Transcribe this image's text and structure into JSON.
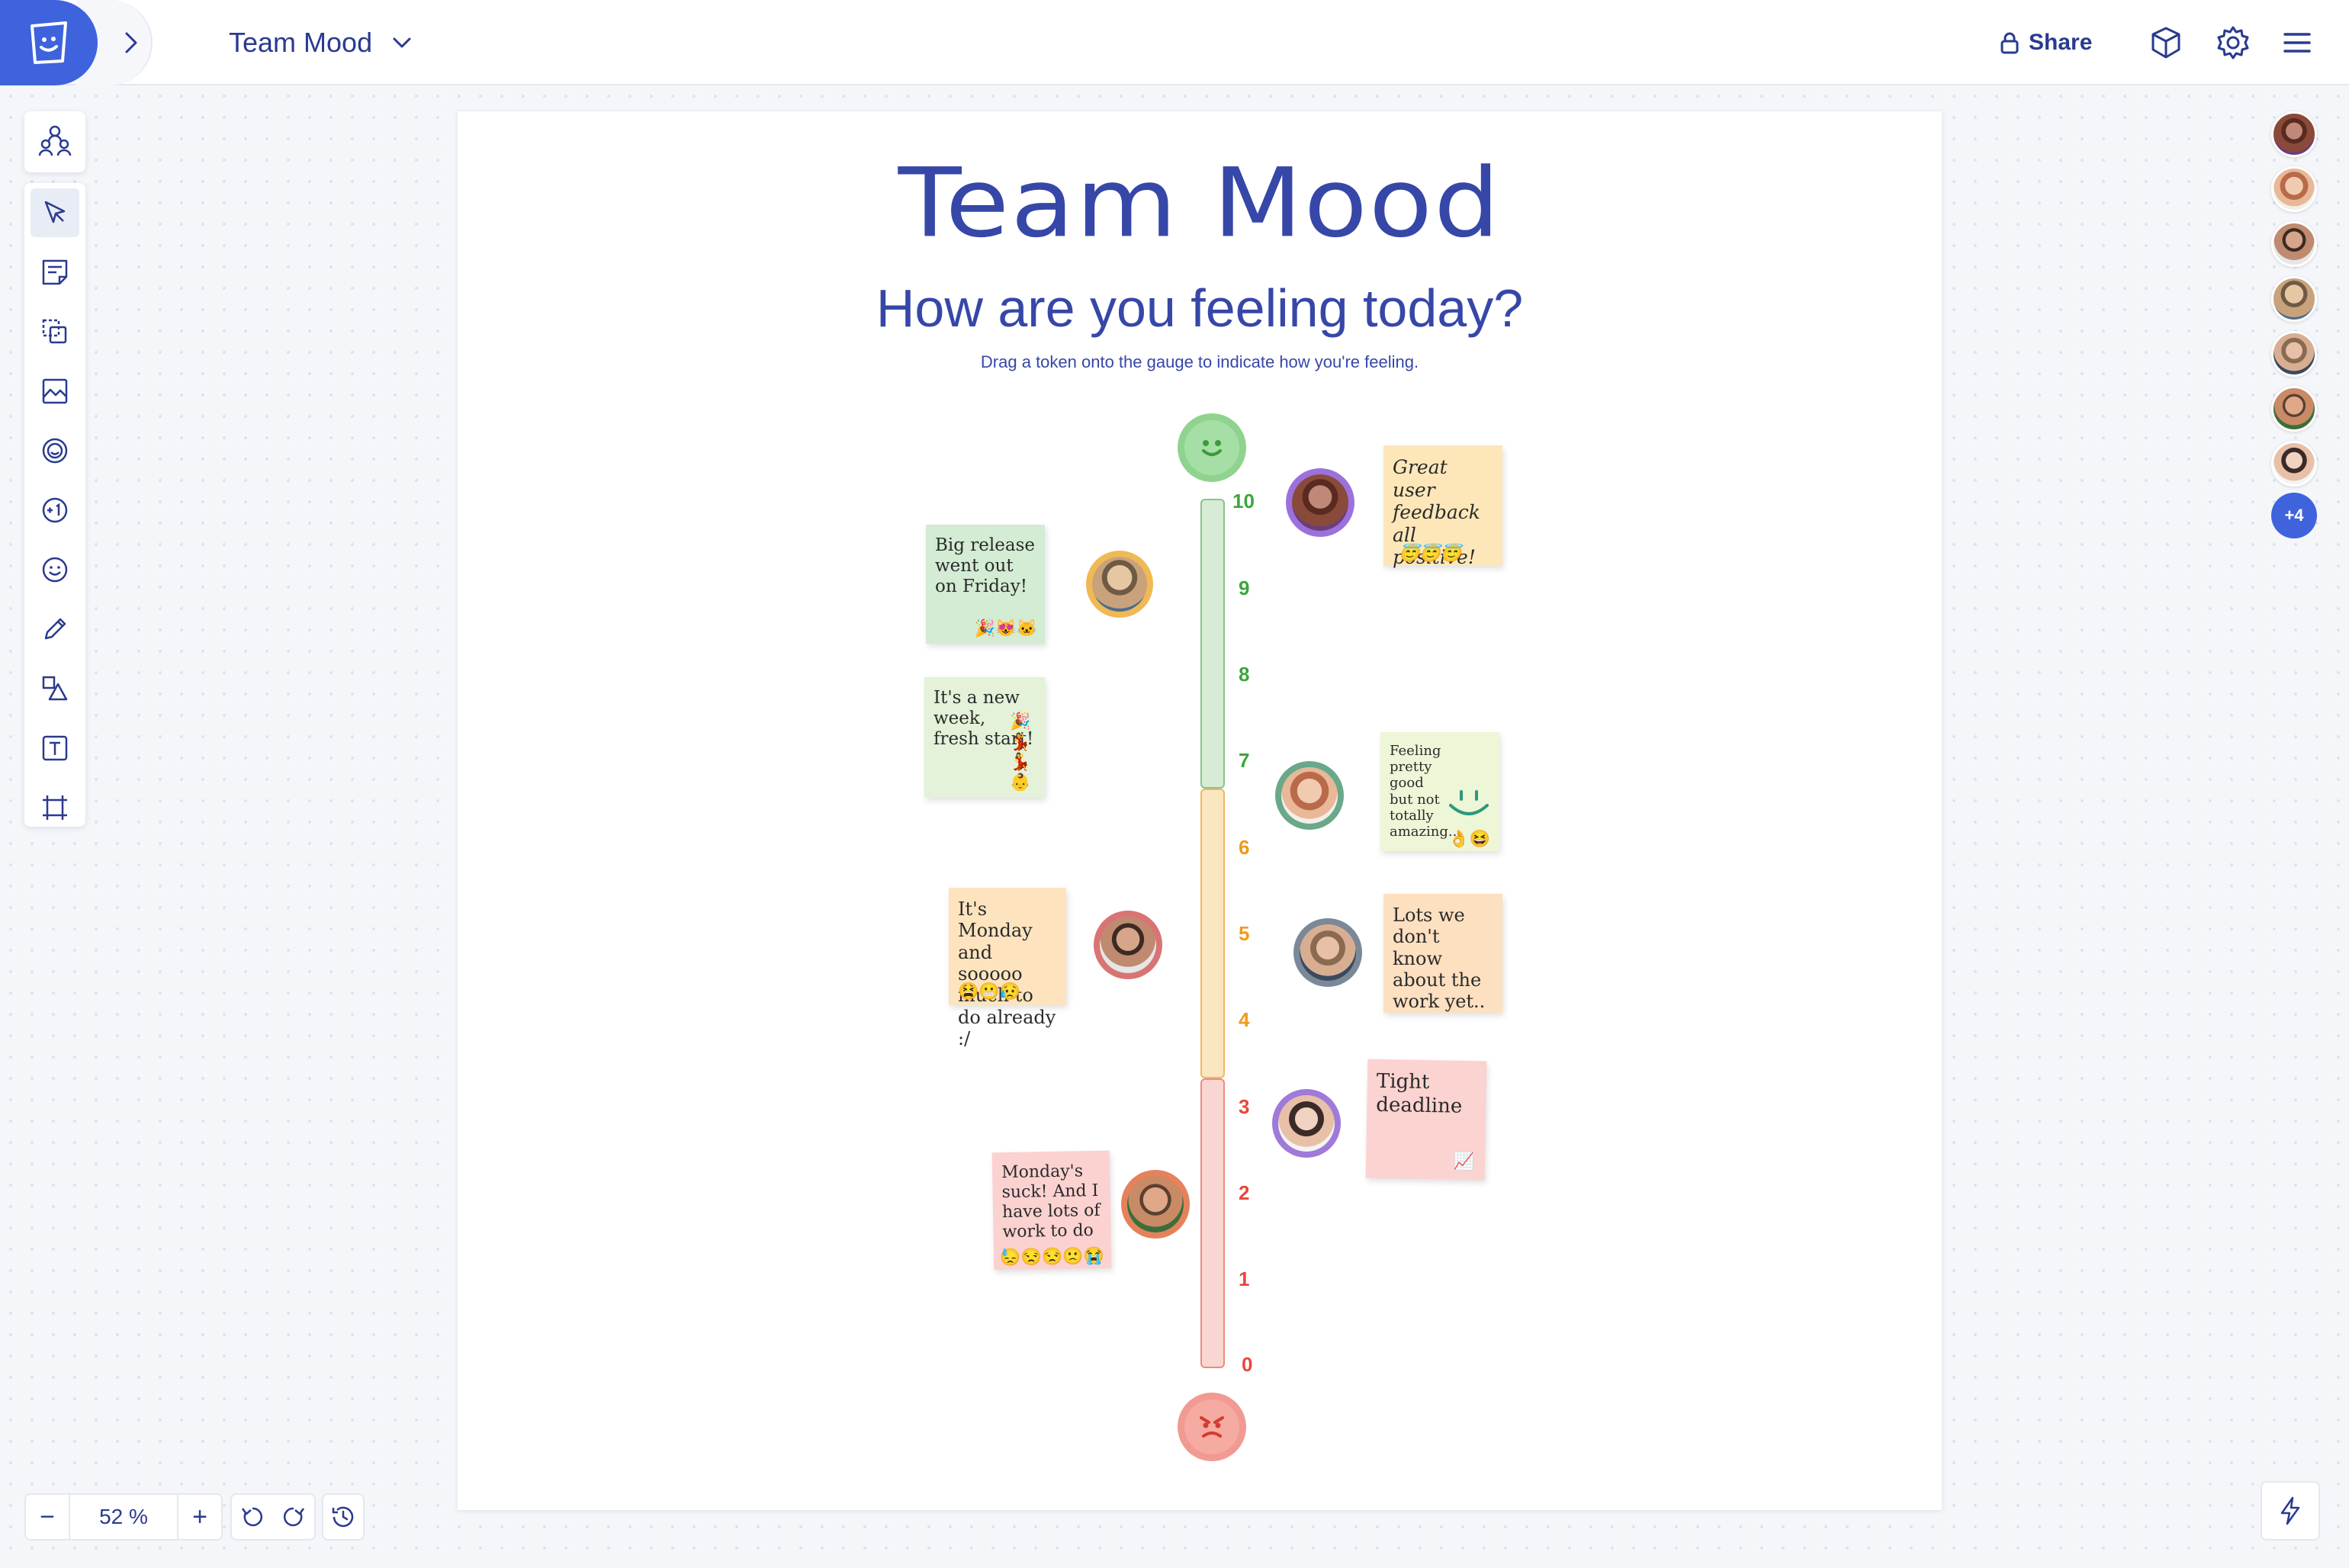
{
  "header": {
    "board_title": "Team Mood",
    "share_label": "Share"
  },
  "board": {
    "title": "Team Mood",
    "subtitle": "How are you feeling today?",
    "hint": "Drag a token onto the gauge to indicate how you're feeling."
  },
  "gauge": {
    "ticks": [
      "10",
      "9",
      "8",
      "7",
      "6",
      "5",
      "4",
      "3",
      "2",
      "1",
      "0"
    ],
    "colors": {
      "good": "#3ca63c",
      "mid": "#f09a1a",
      "bad": "#e8463a"
    }
  },
  "notes": [
    {
      "text": "Big release went out on Friday!",
      "emoji": "🎉😻🐱"
    },
    {
      "text": "It's a new week, fresh start!",
      "emoji": "🎉💃💃👶"
    },
    {
      "text": "It's Monday and sooooo much to do already :/",
      "emoji": "😫😬😥"
    },
    {
      "text": "Monday's suck! And I have lots of work to do",
      "emoji": "😓😒😒🙁😭"
    },
    {
      "text": "Great user feedback all positive!",
      "emoji": "😇😇😇"
    },
    {
      "text": "Feeling pretty good but not totally amazing..",
      "emoji": "👌😆"
    },
    {
      "text": "Lots we don't know about the work yet..",
      "emoji": ""
    },
    {
      "text": "Tight deadline",
      "emoji": "📈"
    }
  ],
  "collaborators": {
    "more_label": "+4"
  },
  "zoom": {
    "value": "52 %",
    "minus": "−",
    "plus": "+"
  }
}
